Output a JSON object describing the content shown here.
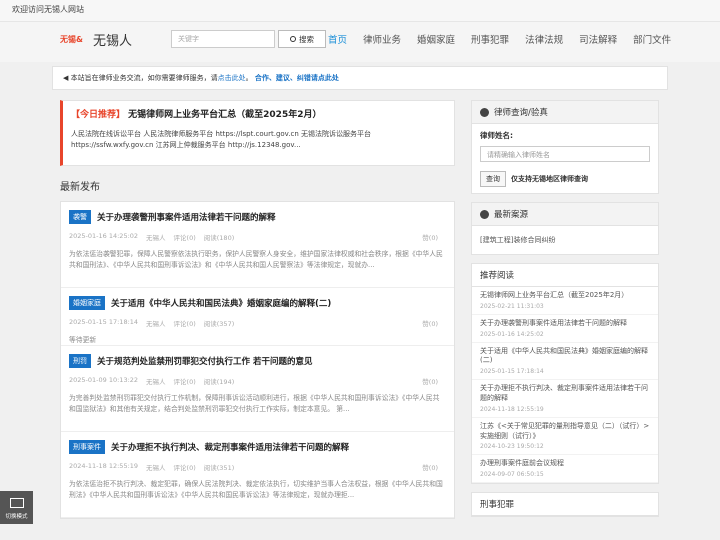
{
  "topbar": {
    "welcome": "欢迎访问无锡人网站"
  },
  "header": {
    "logo_mark": "无锡&",
    "site_name": "无锡人",
    "search_placeholder": "关键字",
    "search_button": "搜索",
    "nav": [
      "首页",
      "律师业务",
      "婚姻家庭",
      "刑事犯罪",
      "法律法规",
      "司法解释",
      "部门文件"
    ]
  },
  "notice": {
    "text_pre": "本站旨在律师业务交流，如你需要律师服务，请",
    "link_click": "点击此处",
    "sep": "。",
    "link_feedback": "合作、建议、纠错请点此处"
  },
  "featured": {
    "tag": "【今日推荐】",
    "title": "无锡律师网上业务平台汇总（截至2025年2月）",
    "text": "人民法院在线诉讼平台 人民法院律师服务平台 https://lspt.court.gov.cn 无锡法院诉讼服务平台 https://ssfw.wxfy.gov.cn 江苏网上仲裁服务平台 http://js.12348.gov..."
  },
  "latest_title": "最新发布",
  "posts": [
    {
      "category": "袭警",
      "title": "关于办理袭警刑事案件适用法律若干问题的解释",
      "date": "2025-01-16 14:25:02",
      "author": "无锡人",
      "comments": "评论(0)",
      "views": "阅读(180)",
      "likes": "赞(0)",
      "excerpt": "为依法惩治袭警犯罪，保障人民警察依法执行职务，保护人民警察人身安全，维护国家法律权威和社会秩序，根据《中华人民共和国刑法》、《中华人民共和国刑事诉讼法》和《中华人民共和国人民警察法》等法律规定，现就办..."
    },
    {
      "category": "婚姻家庭",
      "title": "关于适用《中华人民共和国民法典》婚姻家庭编的解释(二)",
      "date": "2025-01-15 17:18:14",
      "author": "无锡人",
      "comments": "评论(0)",
      "views": "阅读(357)",
      "likes": "赞(0)",
      "excerpt": "等待更新"
    },
    {
      "category": "刑罚",
      "title": "关于规范判处监禁刑罚罪犯交付执行工作 若干问题的意见",
      "date": "2025-01-09 10:13:22",
      "author": "无锡人",
      "comments": "评论(0)",
      "views": "阅读(194)",
      "likes": "赞(0)",
      "excerpt": "为完善判处监禁刑罚罪犯交付执行工作机制，保障刑事诉讼活动顺利进行，根据《中华人民共和国刑事诉讼法》《中华人民共和国监狱法》和其他有关规定，结合判处监禁刑罚罪犯交付执行工作实际，制定本意见。 第..."
    },
    {
      "category": "刑事案件",
      "title": "关于办理拒不执行判决、裁定刑事案件适用法律若干问题的解释",
      "date": "2024-11-18 12:55:19",
      "author": "无锡人",
      "comments": "评论(0)",
      "views": "阅读(351)",
      "likes": "赞(0)",
      "excerpt": "为依法惩治拒不执行判决、裁定犯罪，确保人民法院判决、裁定依法执行，切实维护当事人合法权益，根据《中华人民共和国刑法》《中华人民共和国刑事诉讼法》《中华人民共和国民事诉讼法》等法律规定，现就办理拒..."
    }
  ],
  "sidebar": {
    "lawyer_box": {
      "title": "律师查询/验真",
      "name_label": "律师姓名:",
      "name_placeholder": "请精确输入律师姓名",
      "query_button": "查询",
      "query_link": "仅支持无锡地区律师查询"
    },
    "cases_box": {
      "title": "最新案源",
      "items": [
        "[建筑工程]装修合同纠纷"
      ]
    },
    "recommend": {
      "title": "推荐阅读",
      "items": [
        {
          "title": "无锡律师网上业务平台汇总（截至2025年2月）",
          "date": "2025-02-21 11:31:03"
        },
        {
          "title": "关于办理袭警刑事案件适用法律若干问题的解释",
          "date": "2025-01-16 14:25:02"
        },
        {
          "title": "关于适用《中华人民共和国民法典》婚姻家庭编的解释(二)",
          "date": "2025-01-15 17:18:14"
        },
        {
          "title": "关于办理拒不执行判决、裁定刑事案件适用法律若干问题的解释",
          "date": "2024-11-18 12:55:19"
        },
        {
          "title": "江苏《<关于常见犯罪的量刑指导意见（二）（试行）>实施细则（试行）》",
          "date": "2024-10-23 19:50:12"
        },
        {
          "title": "办理刑事案件庭前会议规程",
          "date": "2024-09-07 06:50:15"
        }
      ]
    },
    "crime_box": {
      "title": "刑事犯罪"
    }
  },
  "float_button": {
    "label": "切换模式"
  }
}
